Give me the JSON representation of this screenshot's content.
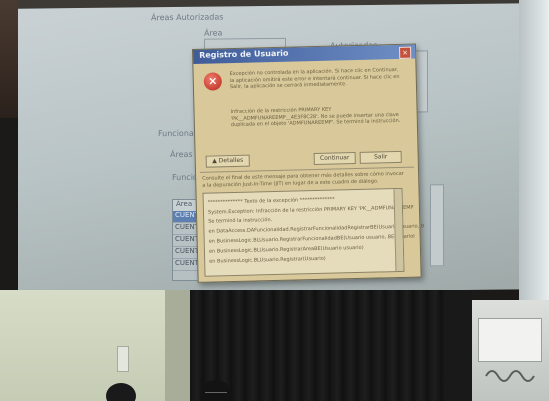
{
  "app": {
    "labels": {
      "areas_autorizadas": "Áreas Autorizadas",
      "area": "Área",
      "autorizadas": "Autorizadas",
      "funcionalidades": "Funcionalidades",
      "areas_au": "Áreas Au",
      "funcione": "Funcione"
    },
    "table": {
      "header": "Área",
      "rows": [
        "CUENTA",
        "CUENTA",
        "CUENTA",
        "CUENTA",
        "CUENTA"
      ]
    }
  },
  "dialog": {
    "title": "Registro de Usuario",
    "close_glyph": "×",
    "error_glyph": "×",
    "message": "Excepción no controlada en la aplicación. Si hace clic en Continuar, la aplicación omitirá este error e intentará continuar. Si hace clic en Salir, la aplicación se cerrará inmediatamente.",
    "message_detail": "Infracción de la restricción PRIMARY KEY 'PK__ADMFUNAREEMP__4E3F8C28'. No se puede insertar una clave duplicada en el objeto 'ADMFUNAREEMP'. Se terminó la instrucción.",
    "buttons": {
      "details": "▲ Detalles",
      "continue": "Continuar",
      "exit": "Salir"
    },
    "hint": "Consulte el final de este mensaje para obtener más detalles sobre cómo invocar a la depuración Just-In-Time (JIT) en lugar de a este cuadro de diálogo.",
    "details_lines": [
      "************** Texto de la excepción **************",
      "System.Exception: Infracción de la restricción PRIMARY KEY 'PK__ADMFUNAREEMP",
      "Se terminó la instrucción.",
      "   en DataAccess.DAFuncionalidad.RegistrarFuncionalidadRegistrarBE(Usuario usuario, B",
      "   en BusinessLogic.BLUsuario.RegistrarFuncionalidadBE(Usuario usuario, BEUsuarioI",
      "   en BusinessLogic.BLUsuario.RegistrarAreaBE(Usuario usuario)",
      "   en BusinessLogic.BLUsuario.Registrar(Usuario)"
    ]
  },
  "colors": {
    "titlebar": "#3f5c99",
    "dialog_bg": "#d8c89a",
    "selected_row": "#5d7fb2"
  }
}
